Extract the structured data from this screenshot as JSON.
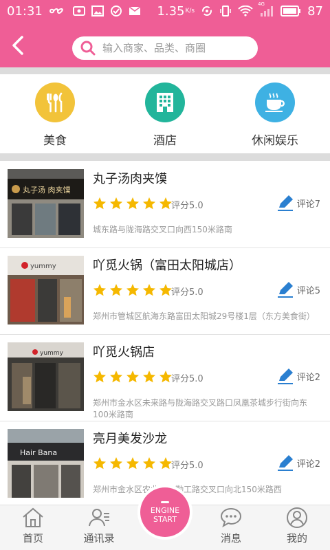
{
  "status_bar": {
    "time": "01:31",
    "speed": "1.35",
    "speed_unit": "K/s",
    "network": "4G",
    "battery": "87"
  },
  "header": {
    "search_placeholder": "输入商家、品类、商圈"
  },
  "categories": [
    {
      "label": "美食",
      "icon": "fork-spoon-knife-icon",
      "color": "#f2c33a"
    },
    {
      "label": "酒店",
      "icon": "hotel-building-icon",
      "color": "#22b59b"
    },
    {
      "label": "休闲娱乐",
      "icon": "coffee-cup-icon",
      "color": "#3eb1e3"
    }
  ],
  "shops": [
    {
      "name": "丸子汤肉夹馍",
      "rating": "评分5.0",
      "stars": 5,
      "comments": "评论7",
      "address": "城东路与陇海路交叉口向西150米路南"
    },
    {
      "name": "吖觅火锅（富田太阳城店）",
      "rating": "评分5.0",
      "stars": 5,
      "comments": "评论5",
      "address": "郑州市管城区航海东路富田太阳城29号楼1层（东方美食街）"
    },
    {
      "name": "吖觅火锅店",
      "rating": "评分5.0",
      "stars": 5,
      "comments": "评论2",
      "address": "郑州市金水区未来路与陇海路交叉路口凤凰茶城步行街向东100米路南"
    },
    {
      "name": "亮月美发沙龙",
      "rating": "评分5.0",
      "stars": 5,
      "comments": "评论2",
      "address": "郑州市金水区农业路与勤工路交叉口向北150米路西"
    }
  ],
  "thumb_signs": {
    "shop1": "丸子汤   肉夹馍",
    "shop2": "yummy",
    "shop3": "yummy",
    "shop4": "Hair Bana"
  },
  "nav": {
    "home": "首页",
    "contacts": "通讯录",
    "engine_line1": "ENGINE",
    "engine_line2": "START",
    "messages": "消息",
    "mine": "我的"
  },
  "colors": {
    "brand": "#ef5e96",
    "star": "#f5b800",
    "comment_icon": "#2a7fd0"
  }
}
